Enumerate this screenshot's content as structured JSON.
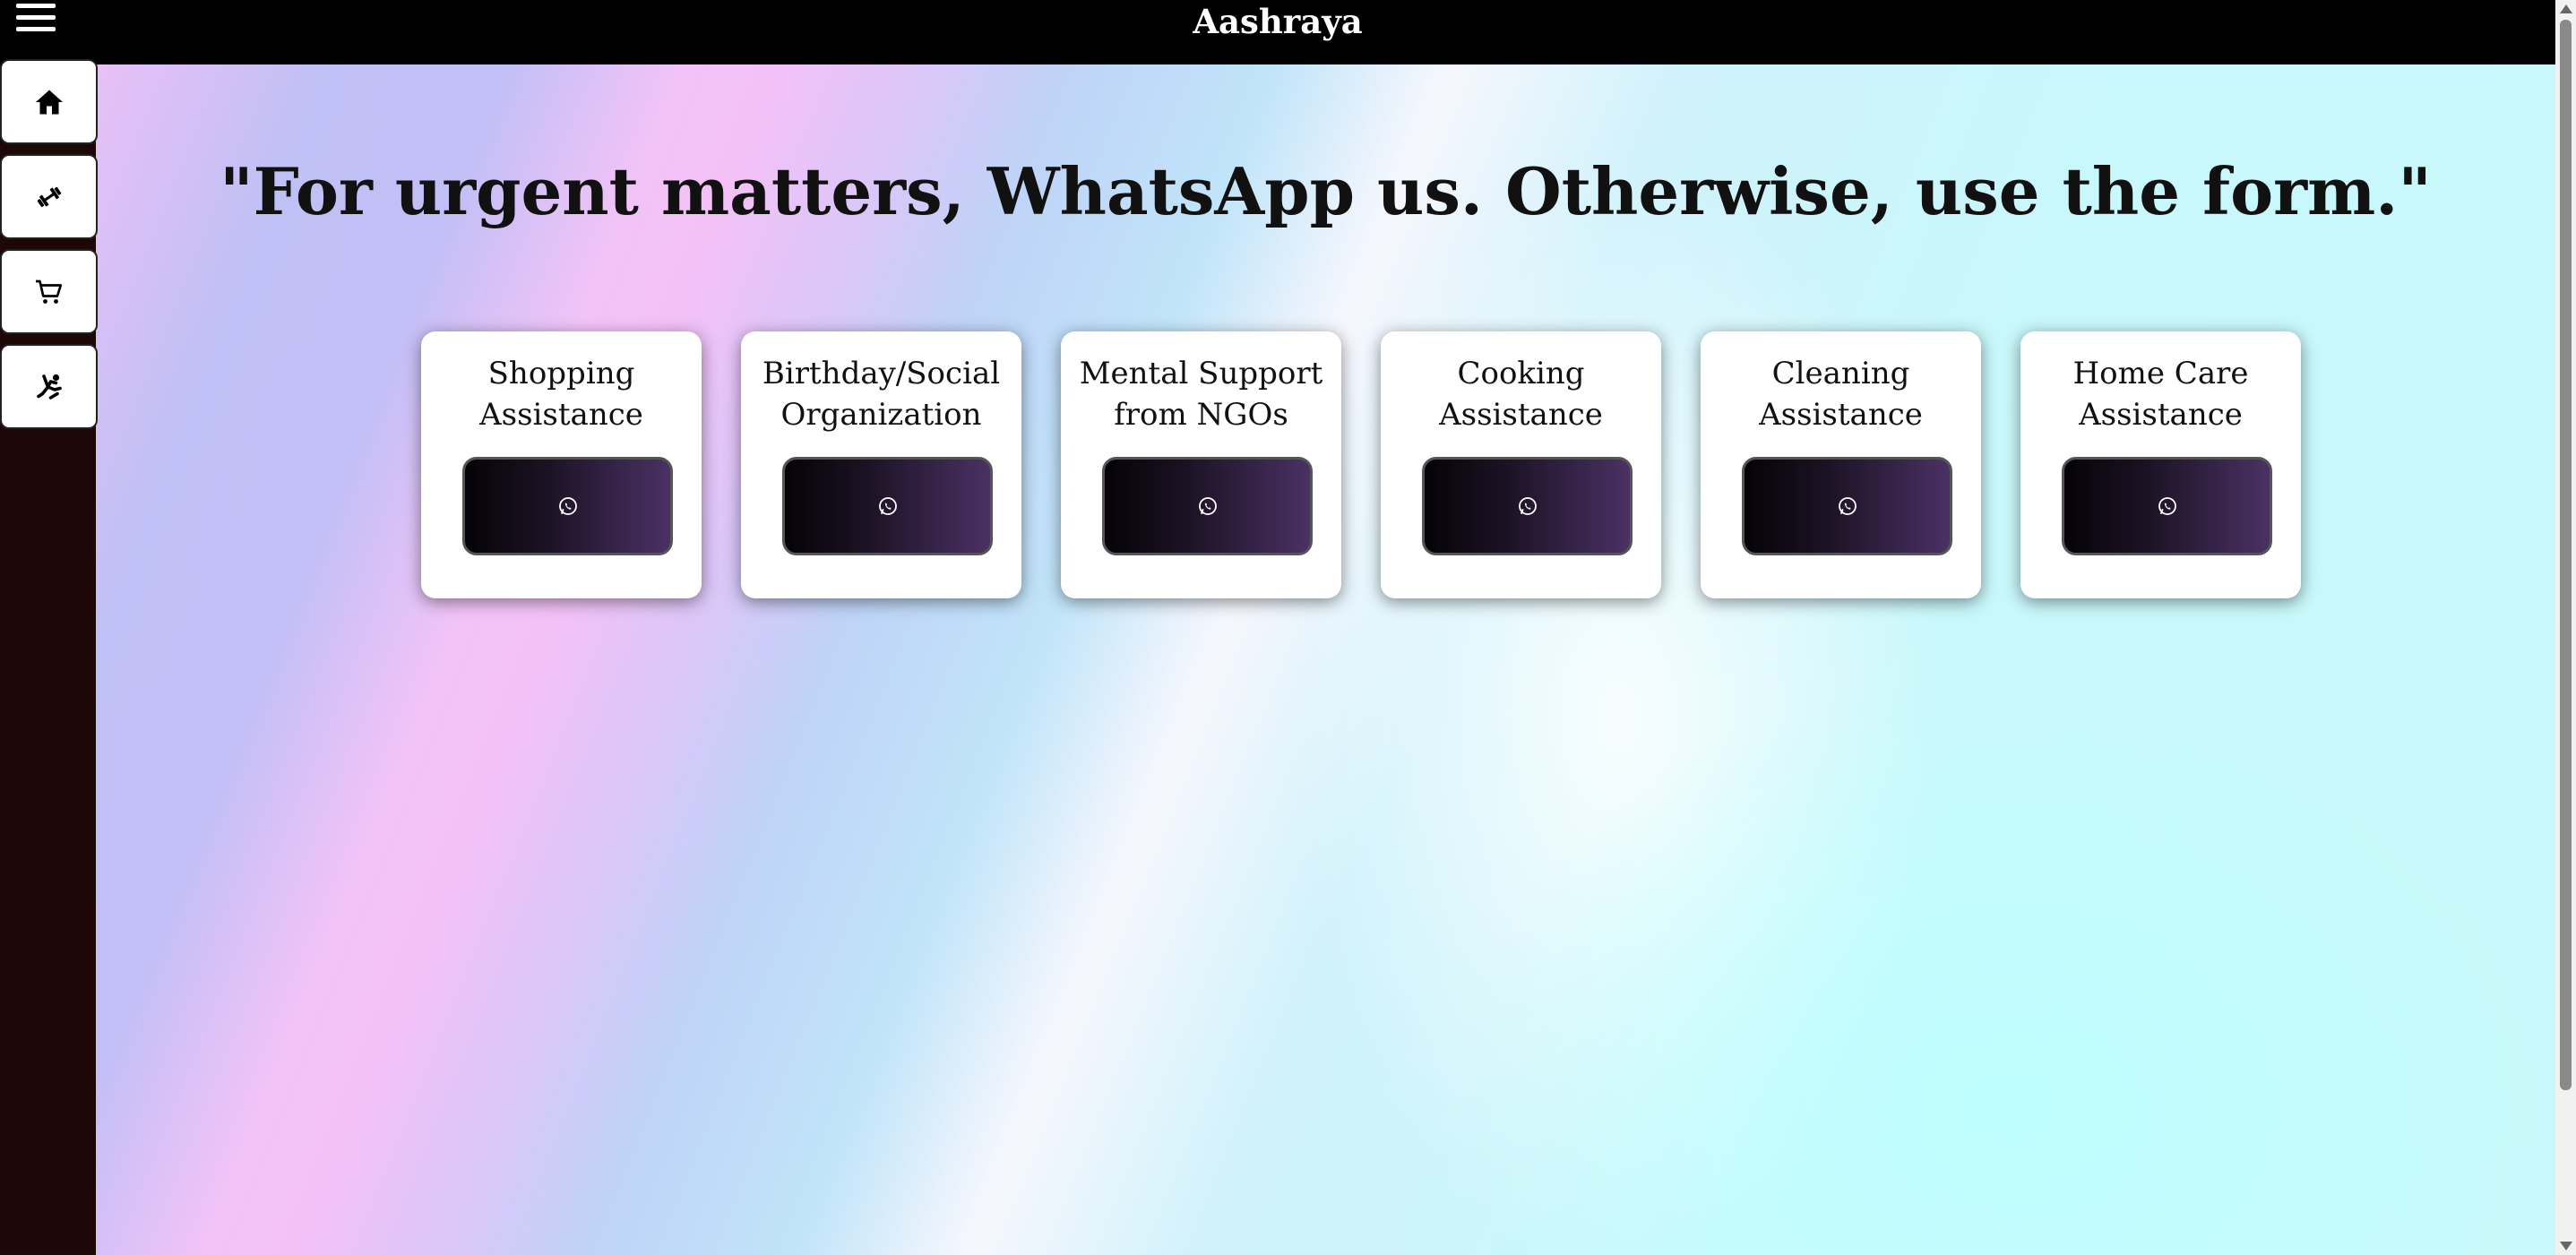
{
  "header": {
    "title": "Aashraya"
  },
  "sidebar": {
    "items": [
      {
        "icon": "home-icon"
      },
      {
        "icon": "dumbbell-icon"
      },
      {
        "icon": "cart-icon"
      },
      {
        "icon": "person-activity-icon"
      }
    ]
  },
  "main": {
    "headline": "\"For urgent matters, WhatsApp us. Otherwise, use the form.\"",
    "cards": [
      {
        "title": "Shopping\nAssistance",
        "button_icon": "whatsapp-icon"
      },
      {
        "title": "Birthday/Social\nOrganization",
        "button_icon": "whatsapp-icon"
      },
      {
        "title": "Mental Support\nfrom NGOs",
        "button_icon": "whatsapp-icon"
      },
      {
        "title": "Cooking\nAssistance",
        "button_icon": "whatsapp-icon"
      },
      {
        "title": "Cleaning\nAssistance",
        "button_icon": "whatsapp-icon"
      },
      {
        "title": "Home Care\nAssistance",
        "button_icon": "whatsapp-icon"
      }
    ]
  },
  "colors": {
    "topbar": "#000000",
    "sidebar": "#1e0707",
    "button_gradient_start": "#050307",
    "button_gradient_end": "#4a3164"
  }
}
